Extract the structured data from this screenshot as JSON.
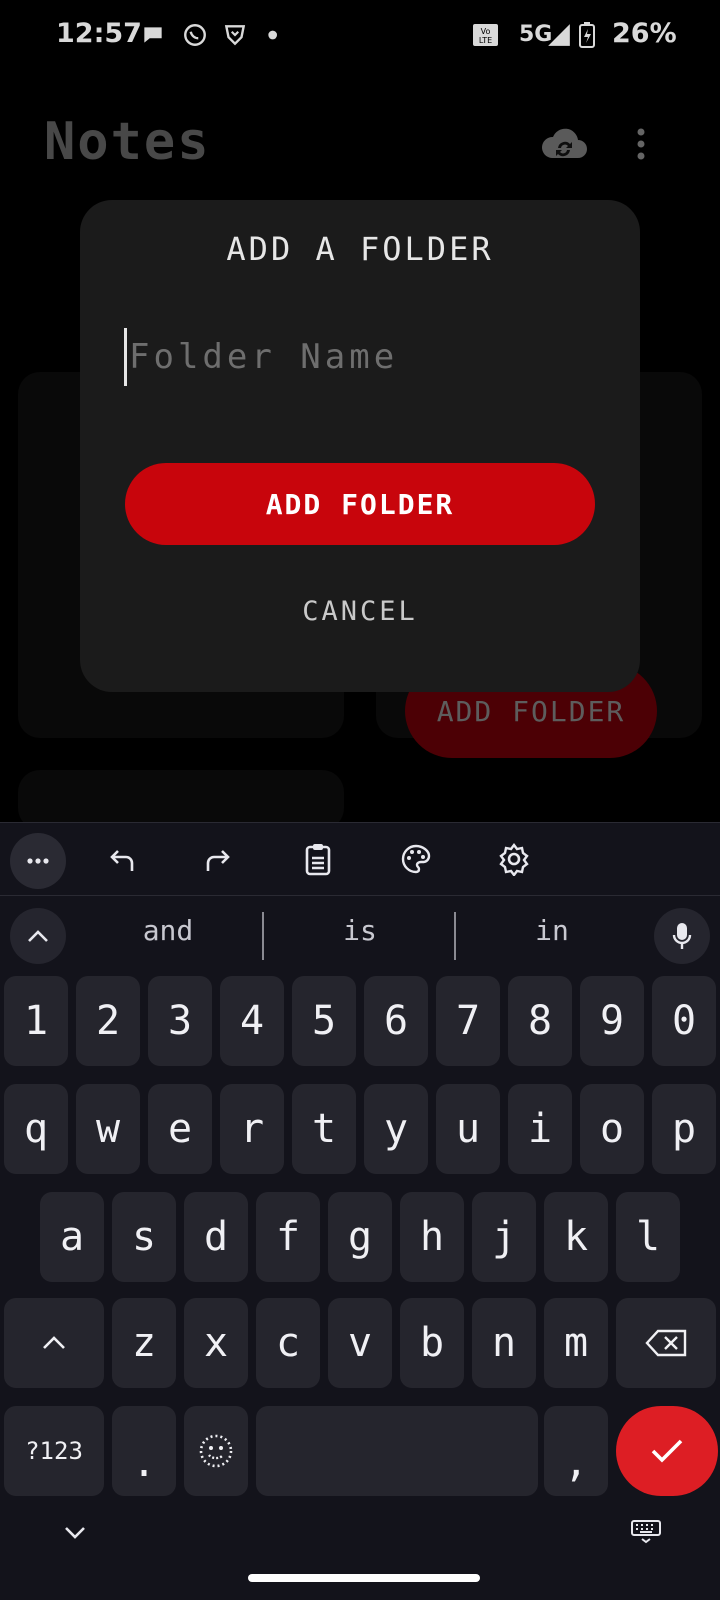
{
  "status_bar": {
    "time": "12:57",
    "network": "5G",
    "battery": "26%",
    "icons": [
      "message-bubble-icon",
      "whatsapp-icon",
      "brave-icon",
      "dot-icon",
      "volte-icon",
      "signal-icon",
      "battery-charging-icon"
    ]
  },
  "app": {
    "title": "Notes",
    "sync_icon": "cloud-sync-icon",
    "menu_icon": "more-vert-icon",
    "background_button": "ADD FOLDER"
  },
  "dialog": {
    "title": "ADD A FOLDER",
    "input_placeholder": "Folder Name",
    "input_value": "",
    "primary_button": "ADD FOLDER",
    "cancel_button": "CANCEL"
  },
  "keyboard": {
    "toolbar": [
      "more-icon",
      "undo-icon",
      "redo-icon",
      "clipboard-icon",
      "palette-icon",
      "settings-icon"
    ],
    "suggestions": [
      "and",
      "is",
      "in"
    ],
    "rows": {
      "numbers": [
        "1",
        "2",
        "3",
        "4",
        "5",
        "6",
        "7",
        "8",
        "9",
        "0"
      ],
      "row1": [
        "q",
        "w",
        "e",
        "r",
        "t",
        "y",
        "u",
        "i",
        "o",
        "p"
      ],
      "row2": [
        "a",
        "s",
        "d",
        "f",
        "g",
        "h",
        "j",
        "k",
        "l"
      ],
      "row3": [
        "z",
        "x",
        "c",
        "v",
        "b",
        "n",
        "m"
      ]
    },
    "symbols_key": "?123",
    "period_key": ".",
    "comma_key": ",",
    "accent_color": "#dd1e24"
  },
  "colors": {
    "dialog_bg": "#1b1b1b",
    "primary_red": "#c8050c",
    "keyboard_bg": "#13131b",
    "key_bg": "#25252d"
  }
}
